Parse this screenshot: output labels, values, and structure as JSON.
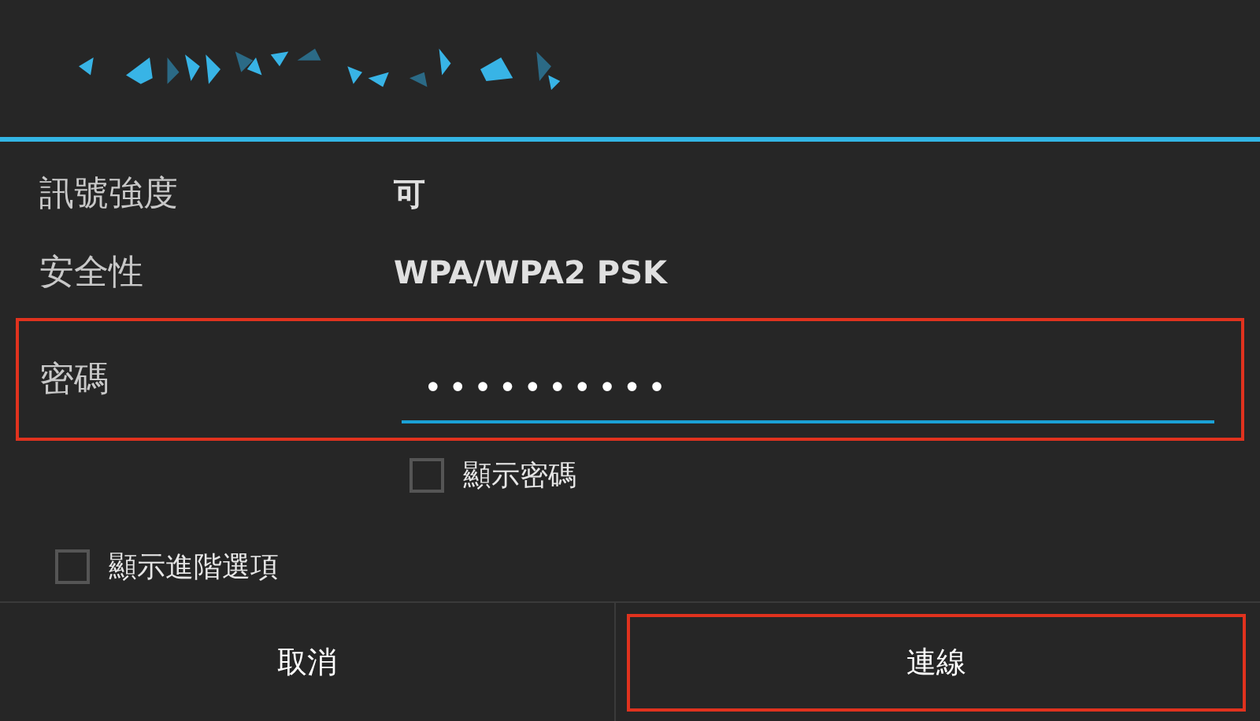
{
  "dialog": {
    "title_redacted": true
  },
  "info_rows": [
    {
      "label": "訊號強度",
      "value": "可"
    },
    {
      "label": "安全性",
      "value": "WPA/WPA2 PSK"
    }
  ],
  "password": {
    "label": "密碼",
    "value": "••••••••••",
    "highlighted": true
  },
  "show_password": {
    "label": "顯示密碼",
    "checked": false
  },
  "advanced_options": {
    "label": "顯示進階選項",
    "checked": false
  },
  "buttons": [
    {
      "label": "取消",
      "highlighted": false
    },
    {
      "label": "連線",
      "highlighted": true
    }
  ]
}
